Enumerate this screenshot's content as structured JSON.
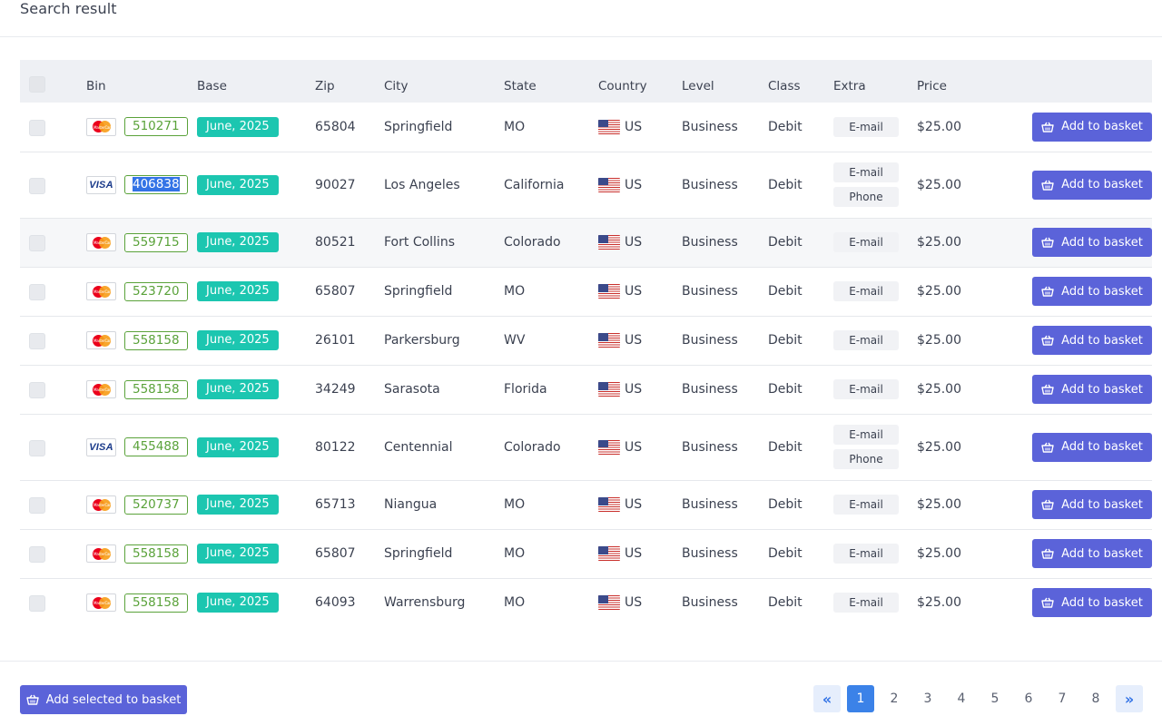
{
  "page": {
    "title": "Search result"
  },
  "table": {
    "headers": {
      "bin": "Bin",
      "base": "Base",
      "zip": "Zip",
      "city": "City",
      "state": "State",
      "country": "Country",
      "level": "Level",
      "class": "Class",
      "extra": "Extra",
      "price": "Price"
    },
    "rows": [
      {
        "brand": "mastercard",
        "bin": "510271",
        "base": "June, 2025",
        "zip": "65804",
        "city": "Springfield",
        "state": "MO",
        "country": "US",
        "level": "Business",
        "class": "Debit",
        "extras": [
          "E-mail"
        ],
        "price": "$25.00",
        "action": "Add to basket"
      },
      {
        "brand": "visa",
        "bin": "406838",
        "bin_selected": true,
        "base": "June, 2025",
        "zip": "90027",
        "city": "Los Angeles",
        "state": "California",
        "country": "US",
        "level": "Business",
        "class": "Debit",
        "extras": [
          "E-mail",
          "Phone"
        ],
        "price": "$25.00",
        "action": "Add to basket"
      },
      {
        "brand": "mastercard",
        "bin": "559715",
        "base": "June, 2025",
        "zip": "80521",
        "city": "Fort Collins",
        "state": "Colorado",
        "country": "US",
        "level": "Business",
        "class": "Debit",
        "extras": [
          "E-mail"
        ],
        "price": "$25.00",
        "action": "Add to basket"
      },
      {
        "brand": "mastercard",
        "bin": "523720",
        "base": "June, 2025",
        "zip": "65807",
        "city": "Springfield",
        "state": "MO",
        "country": "US",
        "level": "Business",
        "class": "Debit",
        "extras": [
          "E-mail"
        ],
        "price": "$25.00",
        "action": "Add to basket"
      },
      {
        "brand": "mastercard",
        "bin": "558158",
        "base": "June, 2025",
        "zip": "26101",
        "city": "Parkersburg",
        "state": "WV",
        "country": "US",
        "level": "Business",
        "class": "Debit",
        "extras": [
          "E-mail"
        ],
        "price": "$25.00",
        "action": "Add to basket"
      },
      {
        "brand": "mastercard",
        "bin": "558158",
        "base": "June, 2025",
        "zip": "34249",
        "city": "Sarasota",
        "state": "Florida",
        "country": "US",
        "level": "Business",
        "class": "Debit",
        "extras": [
          "E-mail"
        ],
        "price": "$25.00",
        "action": "Add to basket"
      },
      {
        "brand": "visa",
        "bin": "455488",
        "base": "June, 2025",
        "zip": "80122",
        "city": "Centennial",
        "state": "Colorado",
        "country": "US",
        "level": "Business",
        "class": "Debit",
        "extras": [
          "E-mail",
          "Phone"
        ],
        "price": "$25.00",
        "action": "Add to basket"
      },
      {
        "brand": "mastercard",
        "bin": "520737",
        "base": "June, 2025",
        "zip": "65713",
        "city": "Niangua",
        "state": "MO",
        "country": "US",
        "level": "Business",
        "class": "Debit",
        "extras": [
          "E-mail"
        ],
        "price": "$25.00",
        "action": "Add to basket"
      },
      {
        "brand": "mastercard",
        "bin": "558158",
        "base": "June, 2025",
        "zip": "65807",
        "city": "Springfield",
        "state": "MO",
        "country": "US",
        "level": "Business",
        "class": "Debit",
        "extras": [
          "E-mail"
        ],
        "price": "$25.00",
        "action": "Add to basket"
      },
      {
        "brand": "mastercard",
        "bin": "558158",
        "base": "June, 2025",
        "zip": "64093",
        "city": "Warrensburg",
        "state": "MO",
        "country": "US",
        "level": "Business",
        "class": "Debit",
        "extras": [
          "E-mail"
        ],
        "price": "$25.00",
        "action": "Add to basket"
      }
    ]
  },
  "brand_labels": {
    "visa": "VISA",
    "mastercard": "MasterCard"
  },
  "footer": {
    "add_selected": "Add selected to basket"
  },
  "pagination": {
    "prev": "«",
    "next": "»",
    "pages": [
      "1",
      "2",
      "3",
      "4",
      "5",
      "6",
      "7",
      "8"
    ],
    "current": "1"
  },
  "colors": {
    "primary_button": "#5b63d9",
    "base_badge": "#1cc6b0",
    "bin_badge": "#5aa23a",
    "active_page": "#3b82e8"
  }
}
